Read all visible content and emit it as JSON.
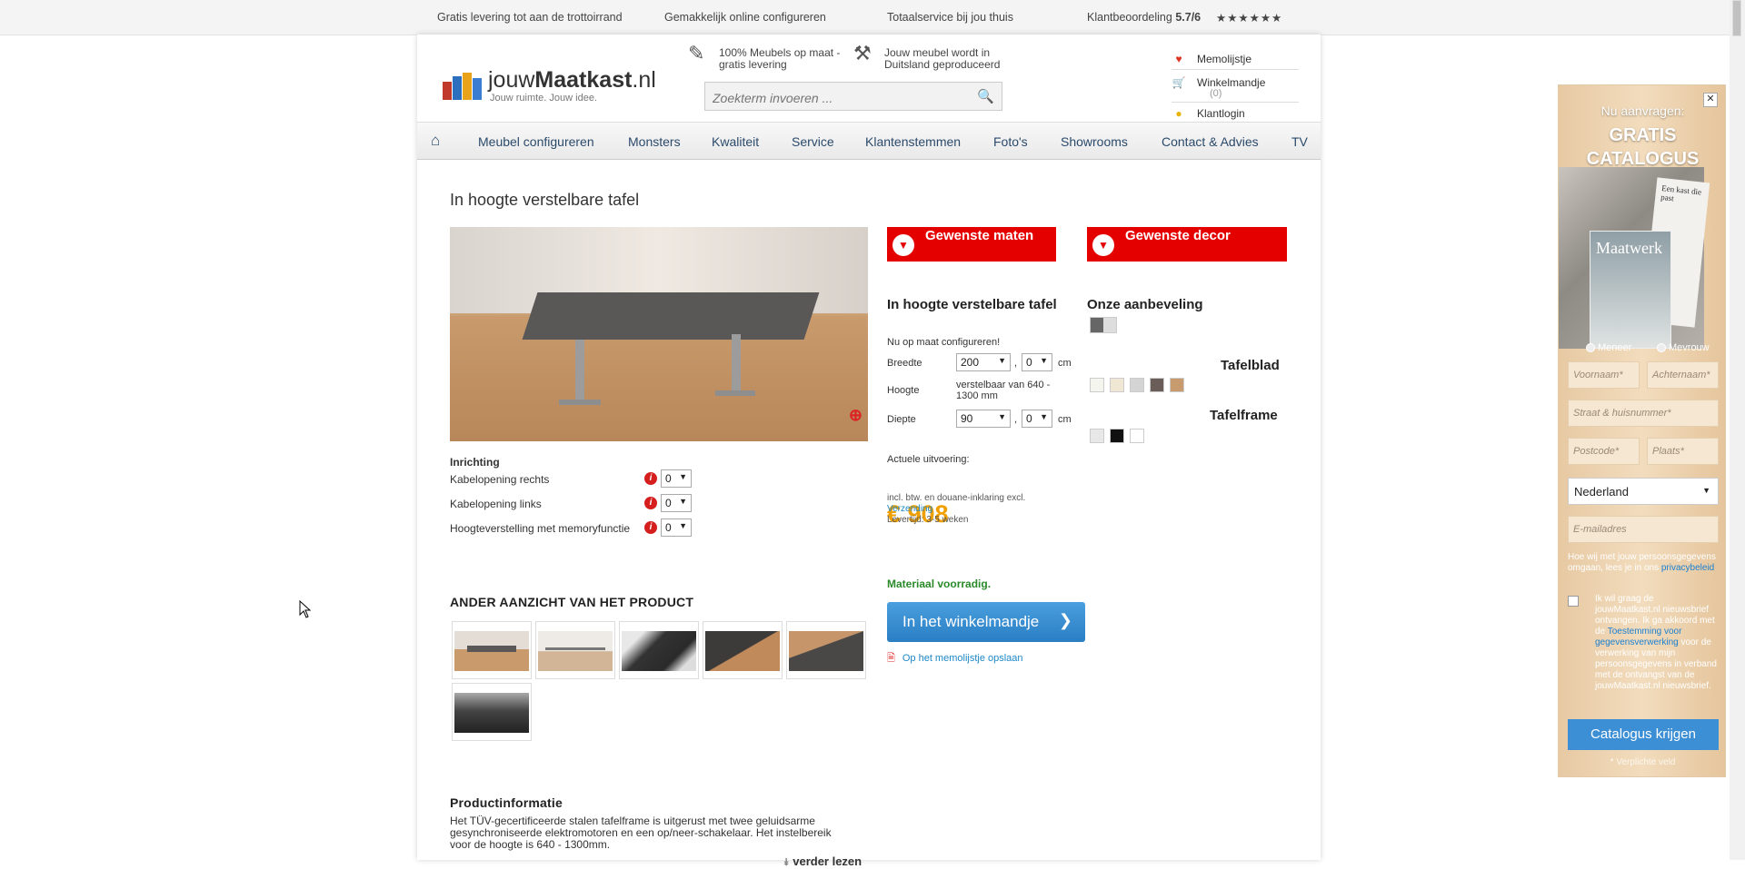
{
  "topbar": {
    "items": [
      "Gratis levering tot aan de trottoirrand",
      "Gemakkelijk online configureren",
      "Totaalservice bij jou thuis",
      "Klantbeoordeling"
    ],
    "rating": "5.7/6",
    "stars": "★★★★★★"
  },
  "header": {
    "logo_prefix": "jouw",
    "logo_bold": "Maatkast",
    "logo_suffix": ".nl",
    "tagline": "Jouw ruimte. Jouw idee.",
    "usp1": "100% Meubels op maat - gratis levering",
    "usp2": "Jouw meubel wordt in Duitsland geproduceerd",
    "search_placeholder": "Zoekterm invoeren ...",
    "memolijstje": "Memolijstje",
    "winkelmandje": "Winkelmandje",
    "cart_count": "(0)",
    "klantlogin": "Klantlogin"
  },
  "nav": {
    "items": [
      "Meubel configureren",
      "Monsters",
      "Kwaliteit",
      "Service",
      "Klantenstemmen",
      "Foto's",
      "Showrooms",
      "Contact & Advies",
      "TV"
    ]
  },
  "product": {
    "title": "In hoogte verstelbare tafel",
    "inrichting_label": "Inrichting",
    "options": [
      {
        "label": "Kabelopening rechts",
        "value": "0"
      },
      {
        "label": "Kabelopening links",
        "value": "0"
      },
      {
        "label": "Hoogteverstelling met memoryfunctie",
        "value": "0"
      }
    ],
    "other_views_title": "ANDER AANZICHT VAN HET PRODUCT",
    "info_title": "Productinformatie",
    "info_text": "Het TÜV-gecertificeerde stalen tafelframe is uitgerust met twee geluidsarme gesynchroniseerde elektromotoren en een op/neer-schakelaar. Het instelbereik voor de hoogte is 640 - 1300mm.",
    "read_more": "verder lezen"
  },
  "config": {
    "btn_sizes": "Gewenste maten",
    "btn_decor": "Gewenste decor",
    "subtitle": "In hoogte verstelbare tafel",
    "intro": "Nu op maat configureren!",
    "breedte_label": "Breedte",
    "breedte_value": "200",
    "breedte_mm": "0",
    "hoogte_label": "Hoogte",
    "hoogte_text": "verstelbaar van 640 - 1300 mm",
    "diepte_label": "Diepte",
    "diepte_value": "90",
    "diepte_mm": "0",
    "unit": "cm",
    "comma": ",",
    "current_label": "Actuele uitvoering:",
    "price": "€ 908",
    "price_note": "incl. btw. en douane-inklaring excl.",
    "shipping": "Verzending",
    "delivery": "Levertijd: 3-5 weken",
    "stock": "Materiaal voorradig.",
    "cart_button": "In het winkelmandje",
    "memo_link": "Op het memolijstje opslaan"
  },
  "decor": {
    "recommend": "Onze aanbeveling",
    "tafelblad": "Tafelblad",
    "tafelframe": "Tafelframe",
    "blad_colors": [
      "#f5f5f0",
      "#efe7d4",
      "#d4d4d4",
      "#6b5e5a",
      "#c79b6e"
    ],
    "frame_colors": [
      "#e8e8e8",
      "#111111",
      "#ffffff"
    ]
  },
  "popup": {
    "line1": "Nu aanvragen:",
    "line2": "GRATIS CATALOGUS",
    "magazine": "Maatwerk",
    "page_text": "Een kast die past",
    "meneer": "Meneer",
    "mevrouw": "Mevrouw",
    "voornaam": "Voornaam*",
    "achternaam": "Achternaam*",
    "straat": "Straat & huisnummer*",
    "postcode": "Postcode*",
    "plaats": "Plaats*",
    "country": "Nederland",
    "email": "E-mailadres",
    "privacy_text": "Hoe wij met jouw persoonsgegevens omgaan, lees je in ons",
    "privacy_link": "privacybeleid",
    "consent_text1": "Ik wil graag de jouwMaatkast.nl nieuwsbrief ontvangen. Ik ga akkoord met de",
    "consent_link": "Toestemming voor gegevensverwerking",
    "consent_text2": "voor de verwerking van mijn persoonsgegevens in verband met de ontvangst van de jouwMaatkast.nl nieuwsbrief.",
    "button": "Catalogus krijgen",
    "required": "* Verplichte veld"
  }
}
